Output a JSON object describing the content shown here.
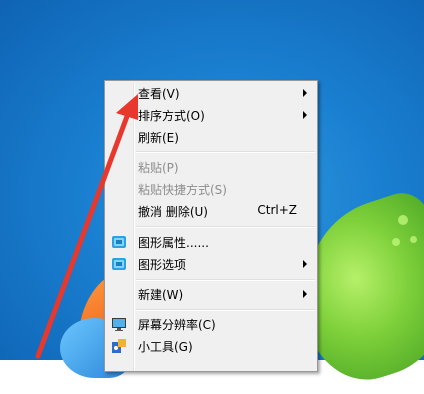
{
  "desktop": {
    "bg_color": "#1a7fd0"
  },
  "context_menu": {
    "items": [
      {
        "label": "查看(V)",
        "submenu": true,
        "disabled": false
      },
      {
        "label": "排序方式(O)",
        "submenu": true,
        "disabled": false
      },
      {
        "label": "刷新(E)",
        "submenu": false,
        "disabled": false
      },
      {
        "label": "粘贴(P)",
        "submenu": false,
        "disabled": true
      },
      {
        "label": "粘贴快捷方式(S)",
        "submenu": false,
        "disabled": true
      },
      {
        "label": "撤消 删除(U)",
        "shortcut": "Ctrl+Z",
        "submenu": false,
        "disabled": false
      },
      {
        "label": "图形属性......",
        "icon": "intel-graphics-icon",
        "submenu": false,
        "disabled": false
      },
      {
        "label": "图形选项",
        "icon": "intel-graphics-icon",
        "submenu": true,
        "disabled": false
      },
      {
        "label": "新建(W)",
        "submenu": true,
        "disabled": false
      },
      {
        "label": "屏幕分辨率(C)",
        "icon": "monitor-icon",
        "submenu": false,
        "disabled": false
      },
      {
        "label": "小工具(G)",
        "icon": "gadgets-icon",
        "submenu": false,
        "disabled": false
      }
    ]
  },
  "annotation": {
    "color": "#e8372c"
  }
}
